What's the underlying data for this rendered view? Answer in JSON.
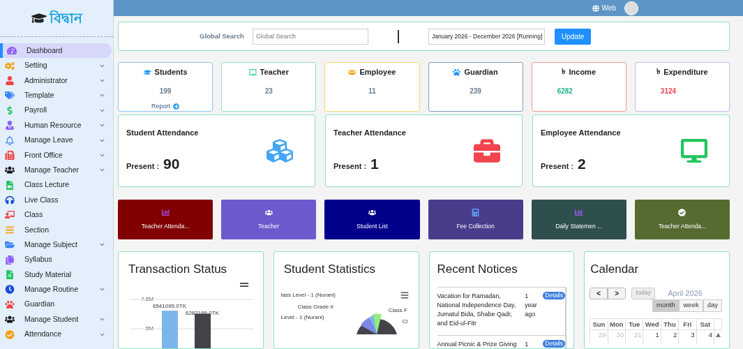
{
  "logo": {
    "text": "বিদ্বান"
  },
  "sidebar": {
    "items": [
      {
        "label": "Dashboard",
        "selected": true,
        "has_submenu": false
      },
      {
        "label": "Setting",
        "selected": false,
        "has_submenu": true
      },
      {
        "label": "Administrator",
        "selected": false,
        "has_submenu": true
      },
      {
        "label": "Template",
        "selected": false,
        "has_submenu": true
      },
      {
        "label": "Payroll",
        "selected": false,
        "has_submenu": true
      },
      {
        "label": "Human Resource",
        "selected": false,
        "has_submenu": true
      },
      {
        "label": "Manage Leave",
        "selected": false,
        "has_submenu": true
      },
      {
        "label": "Front Office",
        "selected": false,
        "has_submenu": true
      },
      {
        "label": "Manage Teacher",
        "selected": false,
        "has_submenu": true
      },
      {
        "label": "Class Lecture",
        "selected": false,
        "has_submenu": false
      },
      {
        "label": "Live Class",
        "selected": false,
        "has_submenu": false
      },
      {
        "label": "Class",
        "selected": false,
        "has_submenu": false
      },
      {
        "label": "Section",
        "selected": false,
        "has_submenu": false
      },
      {
        "label": "Manage Subject",
        "selected": false,
        "has_submenu": true
      },
      {
        "label": "Syllabus",
        "selected": false,
        "has_submenu": false
      },
      {
        "label": "Study Material",
        "selected": false,
        "has_submenu": false
      },
      {
        "label": "Manage Routine",
        "selected": false,
        "has_submenu": true
      },
      {
        "label": "Guardian",
        "selected": false,
        "has_submenu": false
      },
      {
        "label": "Manage Student",
        "selected": false,
        "has_submenu": true
      },
      {
        "label": "Attendance",
        "selected": false,
        "has_submenu": true
      }
    ]
  },
  "header": {
    "web_link": "Web"
  },
  "search_bar": {
    "label": "Global Search",
    "placeholder": "Global Search",
    "session": "January 2026 - December 2026 [Running]",
    "button": "Update"
  },
  "stat_cards": [
    {
      "title": "Students",
      "value": "199",
      "kind": "count",
      "color": "#8ec5f0",
      "link": "Report"
    },
    {
      "title": "Teacher",
      "value": "23",
      "kind": "count",
      "color": "#8fe0c4"
    },
    {
      "title": "Employee",
      "value": "11",
      "kind": "count",
      "color": "#f7d774"
    },
    {
      "title": "Guardian",
      "value": "239",
      "kind": "count",
      "color": "#8a9bb8"
    },
    {
      "title": "Income",
      "currency_sign": "৳",
      "value": "6282",
      "kind": "income",
      "color": "#f19a9a"
    },
    {
      "title": "Expenditure",
      "currency_sign": "৳",
      "value": "3124",
      "kind": "expense",
      "color": "#c9b8f0"
    }
  ],
  "attendance_cards": [
    {
      "title": "Student Attendance",
      "label": "Present :",
      "value": "90"
    },
    {
      "title": "Teacher Attendance",
      "label": "Present :",
      "value": "1"
    },
    {
      "title": "Employee Attendance",
      "label": "Present :",
      "value": "2"
    }
  ],
  "quick_links": [
    {
      "label": "Teacher Attenda...",
      "color": "#800000"
    },
    {
      "label": "Teacher",
      "color": "#6a5acd"
    },
    {
      "label": "Student List",
      "color": "#00008b"
    },
    {
      "label": "Fee Collection",
      "color": "#483d8b"
    },
    {
      "label": "Daily Statemen ...",
      "color": "#2f4f4f"
    },
    {
      "label": "Teacher Attenda...",
      "color": "#556b2f"
    }
  ],
  "transaction_status": {
    "title": "Transaction Status",
    "chart_data": {
      "type": "bar",
      "values": [
        6541095,
        6282195
      ],
      "colors": [
        "#7cb5ec",
        "#434348"
      ],
      "ylim": [
        0,
        7500000
      ],
      "yticks": [
        {
          "value": 5000000,
          "label": "5M"
        },
        {
          "value": 7500000,
          "label": "7.5M"
        }
      ],
      "value_labels": [
        "6541095.0TK",
        "6282195.0TK"
      ]
    }
  },
  "student_statistics": {
    "title": "Student Statistics",
    "labels": [
      "lass Level - 1 (Nurani)",
      "Class Grade II",
      "Level - 1 (Nurani)",
      "Class F",
      "Cl"
    ]
  },
  "recent_notices": {
    "title": "Recent Notices",
    "items": [
      {
        "text": "Vacation for Ramadan, National Independence Day, Jumatul Bida, Shabe Qadr, and Eid-ul-Fitr",
        "time": "1 year ago",
        "button": "Details"
      },
      {
        "text": "Annual Picnic & Prize Giving",
        "time": "1",
        "button": "Details"
      }
    ]
  },
  "calendar": {
    "title": "Calendar",
    "prev": "<",
    "next": ">",
    "today": "today",
    "month_label": "April 2026",
    "views": [
      {
        "label": "month",
        "selected": true
      },
      {
        "label": "week",
        "selected": false
      },
      {
        "label": "day",
        "selected": false
      }
    ],
    "weekdays": [
      "Sun",
      "Mon",
      "Tue",
      "Wed",
      "Thu",
      "Fri",
      "Sat"
    ],
    "days": [
      {
        "day": "29",
        "other_month": true
      },
      {
        "day": "30",
        "other_month": true
      },
      {
        "day": "31",
        "other_month": true
      },
      {
        "day": "1",
        "other_month": false
      },
      {
        "day": "2",
        "other_month": false
      },
      {
        "day": "3",
        "other_month": false
      },
      {
        "day": "4",
        "other_month": false
      }
    ]
  }
}
